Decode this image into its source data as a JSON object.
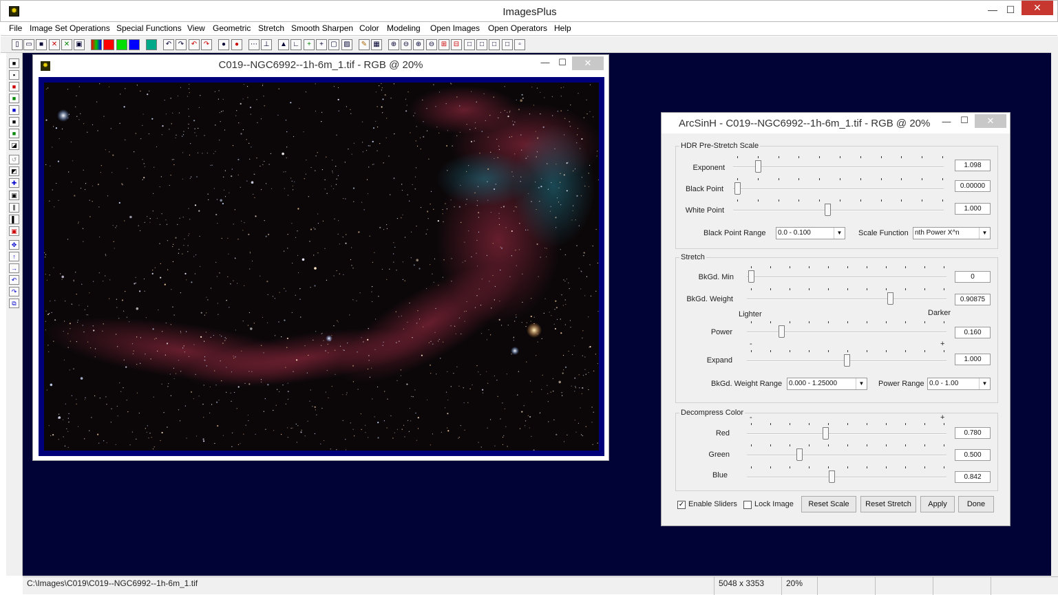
{
  "app": {
    "title": "ImagesPlus",
    "minimize": "—",
    "maximize": "☐",
    "close": "✕"
  },
  "menu": [
    "File",
    "Image Set Operations",
    "Special Functions",
    "View",
    "Geometric",
    "Stretch",
    "Smooth Sharpen",
    "Color",
    "Modeling",
    "Open Images",
    "Open Operators",
    "Help"
  ],
  "image_window": {
    "title": "C019--NGC6992--1h-6m_1.tif - RGB @ 20%",
    "minimize": "—",
    "maximize": "☐",
    "close": "✕"
  },
  "dialog": {
    "title": "ArcSinH - C019--NGC6992--1h-6m_1.tif - RGB @ 20%",
    "minimize": "—",
    "maximize": "☐",
    "close": "✕",
    "hdr": {
      "label": "HDR Pre-Stretch Scale",
      "exponent_label": "Exponent",
      "exponent_value": "1.098",
      "black_point_label": "Black Point",
      "black_point_value": "0.00000",
      "white_point_label": "White Point",
      "white_point_value": "1.000",
      "bp_range_label": "Black Point Range",
      "bp_range_value": "0.0 - 0.100",
      "scale_fn_label": "Scale Function",
      "scale_fn_value": "nth Power X^n"
    },
    "stretch": {
      "label": "Stretch",
      "bkgd_min_label": "BkGd. Min",
      "bkgd_min_value": "0",
      "bkgd_weight_label": "BkGd. Weight",
      "bkgd_weight_value": "0.90875",
      "lighter": "Lighter",
      "darker": "Darker",
      "power_label": "Power",
      "power_value": "0.160",
      "minus": "-",
      "plus": "+",
      "expand_label": "Expand",
      "expand_value": "1.000",
      "weight_range_label": "BkGd. Weight Range",
      "weight_range_value": "0.000 - 1.25000",
      "power_range_label": "Power Range",
      "power_range_value": "0.0 - 1.00"
    },
    "decompress": {
      "label": "Decompress Color",
      "minus": "-",
      "plus": "+",
      "red_label": "Red",
      "red_value": "0.780",
      "green_label": "Green",
      "green_value": "0.500",
      "blue_label": "Blue",
      "blue_value": "0.842"
    },
    "enable_sliders": "Enable Sliders",
    "lock_image": "Lock Image",
    "reset_scale": "Reset Scale",
    "reset_stretch": "Reset Stretch",
    "apply": "Apply",
    "done": "Done"
  },
  "status": {
    "path": "C:\\Images\\C019\\C019--NGC6992--1h-6m_1.tif",
    "dimensions": "5048 x 3353",
    "zoom": "20%"
  },
  "colors": {
    "workspace": "#010337",
    "image_border": "#00007a"
  }
}
